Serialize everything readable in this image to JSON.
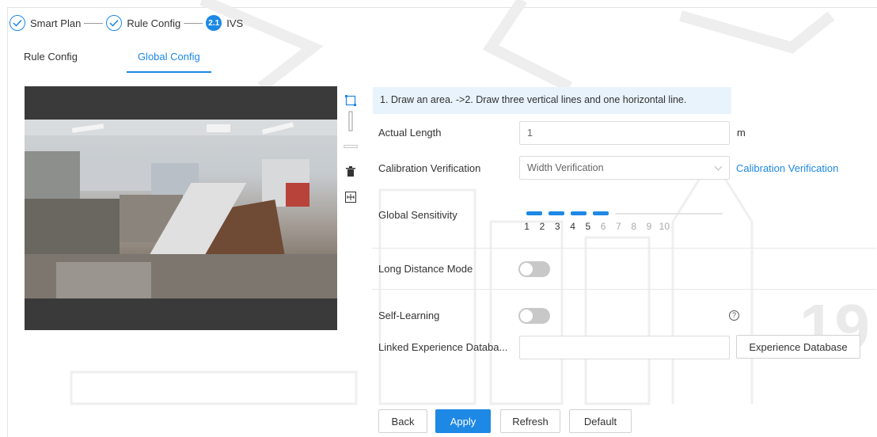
{
  "stepper": {
    "steps": [
      {
        "label": "Smart Plan",
        "state": "done"
      },
      {
        "label": "Rule Config",
        "state": "done"
      },
      {
        "label": "IVS",
        "state": "active",
        "badge": "2.1"
      }
    ]
  },
  "tabs": [
    {
      "label": "Rule Config",
      "active": false
    },
    {
      "label": "Global Config",
      "active": true
    }
  ],
  "toolbar": {
    "icons": [
      "draw-area-icon",
      "vertical-line-icon",
      "horizontal-line-icon",
      "delete-icon",
      "calibration-icon"
    ]
  },
  "form": {
    "hint": "1. Draw an area. ->2. Draw three vertical lines and one horizontal line.",
    "actual_length": {
      "label": "Actual Length",
      "value": "1",
      "unit": "m"
    },
    "calibration": {
      "label": "Calibration Verification",
      "value": "Width Verification",
      "link": "Calibration Verification"
    },
    "sensitivity": {
      "label": "Global Sensitivity",
      "value": 5,
      "ticks": [
        "1",
        "2",
        "3",
        "4",
        "5",
        "6",
        "7",
        "8",
        "9",
        "10"
      ]
    },
    "long_distance": {
      "label": "Long Distance Mode",
      "enabled": false
    },
    "self_learning": {
      "label": "Self-Learning",
      "enabled": false,
      "help": "?"
    },
    "linked_db": {
      "label": "Linked Experience Databa...",
      "value": "",
      "button": "Experience Database"
    }
  },
  "actions": {
    "back": "Back",
    "apply": "Apply",
    "refresh": "Refresh",
    "default": "Default"
  },
  "colors": {
    "accent": "#1e88e5",
    "hint_bg": "#e8f3fc",
    "toggle_off": "#c8c8c8"
  }
}
